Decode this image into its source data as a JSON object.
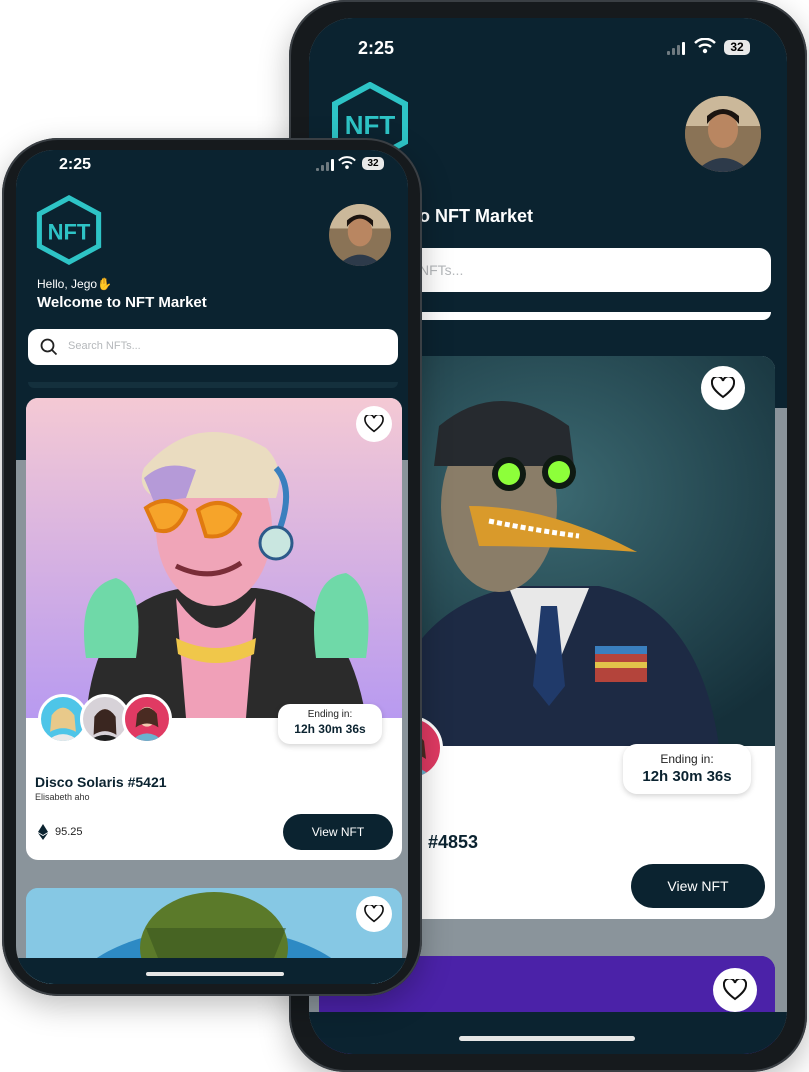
{
  "status": {
    "time": "2:25",
    "battery": "32"
  },
  "brand": {
    "logo_text": "NFT"
  },
  "greeting": {
    "hello": "Hello, Jego",
    "hand_emoji": "✋",
    "welcome": "Welcome to NFT Market",
    "welcome_partial": "o NFT Market"
  },
  "search": {
    "placeholder": "Search NFTs...",
    "placeholder_partial": "NFTs..."
  },
  "front_card": {
    "title": "Disco Solaris #5421",
    "creator": "Elisabeth aho",
    "price": "95.25",
    "ending_label": "Ending in:",
    "ending_value": "12h 30m 36s",
    "button": "View NFT"
  },
  "back_card": {
    "title_partial": "ll #4853",
    "ending_label": "Ending in:",
    "ending_value": "12h 30m 36s",
    "button": "View NFT"
  },
  "colors": {
    "header": "#0b2330",
    "accent_logo": "#2ec4c6",
    "button": "#0b2330"
  },
  "icons": [
    "signal-icon",
    "wifi-icon",
    "battery-icon",
    "nft-logo",
    "profile-avatar",
    "search-icon",
    "heart-icon",
    "ethereum-icon"
  ]
}
